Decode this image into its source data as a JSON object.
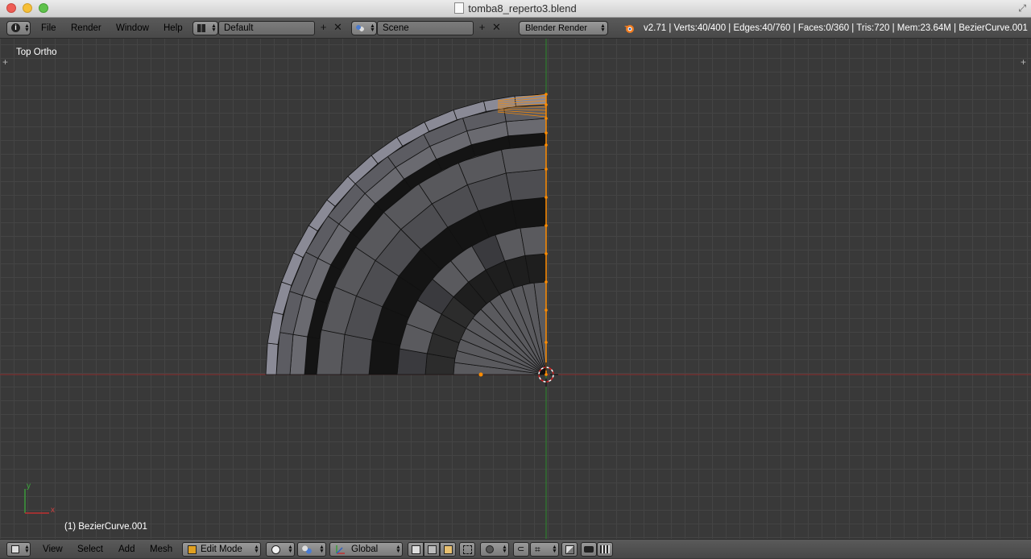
{
  "window": {
    "title": "tomba8_reperto3.blend"
  },
  "topbar": {
    "menu": [
      "File",
      "Render",
      "Window",
      "Help"
    ],
    "screen_layout": "Default",
    "scene": "Scene",
    "render_engine": "Blender Render",
    "stats": "v2.71 | Verts:40/400 | Edges:40/760 | Faces:0/360 | Tris:720 | Mem:23.64M | BezierCurve.001"
  },
  "viewport": {
    "view_name": "Top Ortho",
    "active_object": "(1) BezierCurve.001",
    "axis_y": "y",
    "axis_x": "x",
    "colors": {
      "x_axis": "#8a2a2a",
      "y_axis": "#2a8a2a",
      "selection": "#ff8c00",
      "mesh_face": "#5a5a5e",
      "mesh_dark": "#141414"
    }
  },
  "bottombar": {
    "menu": [
      "View",
      "Select",
      "Add",
      "Mesh"
    ],
    "mode": "Edit Mode",
    "orientation": "Global"
  }
}
